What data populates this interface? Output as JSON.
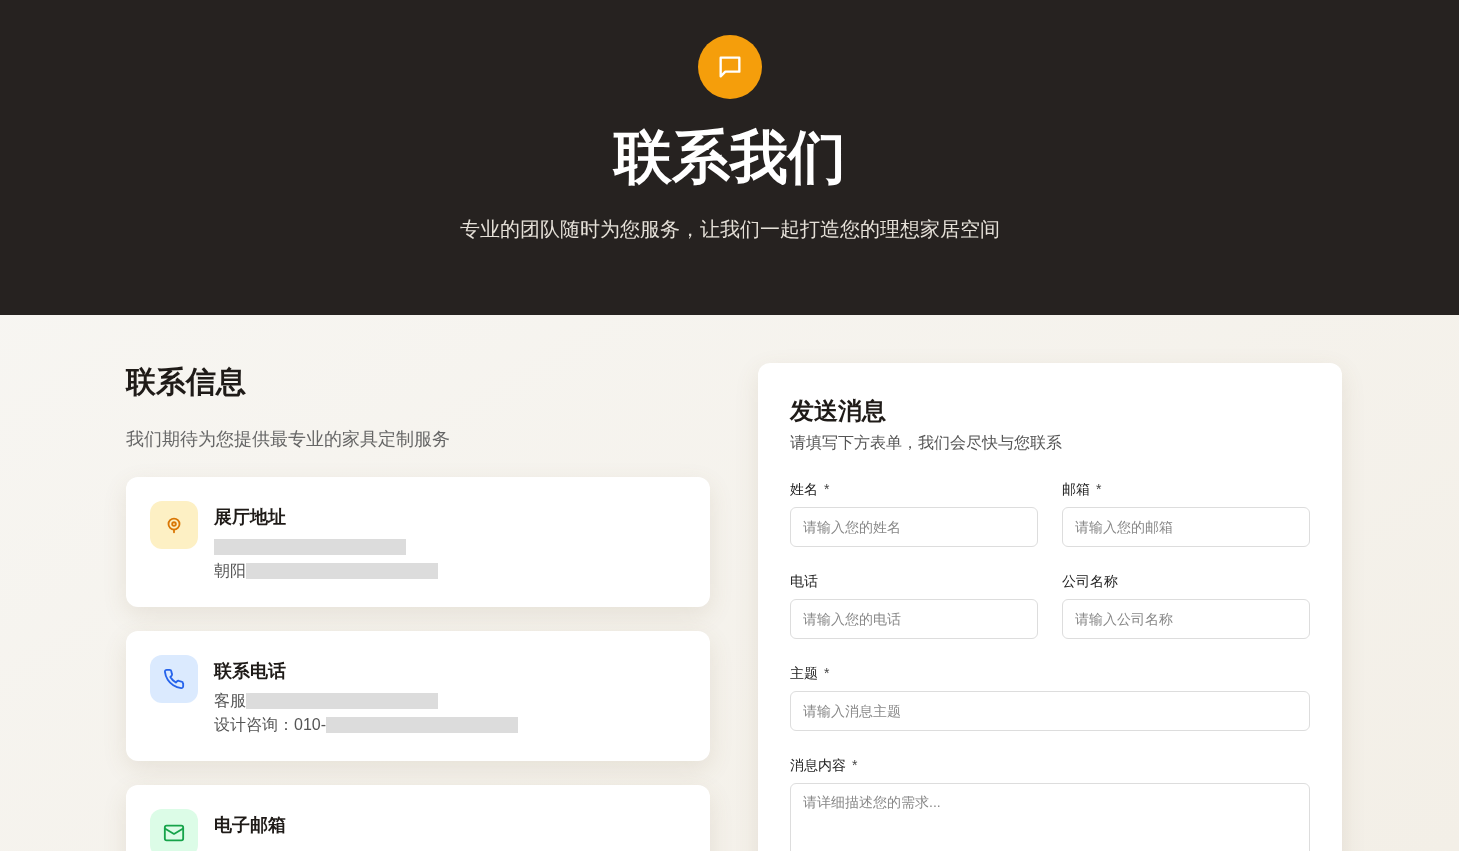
{
  "hero": {
    "title": "联系我们",
    "subtitle": "专业的团队随时为您服务，让我们一起打造您的理想家居空间"
  },
  "contact_info": {
    "title": "联系信息",
    "subtitle": "我们期待为您提供最专业的家具定制服务",
    "cards": [
      {
        "kind": "address",
        "title": "展厅地址",
        "lines": [
          {
            "redacted": true
          },
          {
            "text": "朝阳",
            "redacted": true
          }
        ]
      },
      {
        "kind": "phone",
        "title": "联系电话",
        "lines": [
          {
            "text": "客服",
            "redacted": true
          },
          {
            "text": "设计咨询：010-",
            "redacted": true
          }
        ]
      },
      {
        "kind": "email",
        "title": "电子邮箱"
      }
    ]
  },
  "form": {
    "title": "发送消息",
    "subtitle": "请填写下方表单，我们会尽快与您联系",
    "rows": [
      [
        {
          "label": "姓名",
          "required_mark": "*",
          "placeholder": "请输入您的姓名",
          "kind": "input"
        },
        {
          "label": "邮箱",
          "required_mark": "*",
          "placeholder": "请输入您的邮箱",
          "kind": "input"
        }
      ],
      [
        {
          "label": "电话",
          "placeholder": "请输入您的电话",
          "kind": "input"
        },
        {
          "label": "公司名称",
          "placeholder": "请输入公司名称",
          "kind": "input"
        }
      ],
      [
        {
          "label": "主题",
          "required_mark": "*",
          "placeholder": "请输入消息主题",
          "kind": "input"
        }
      ],
      [
        {
          "label": "消息内容",
          "required_mark": "*",
          "placeholder": "请详细描述您的需求...",
          "kind": "textarea"
        }
      ]
    ]
  }
}
